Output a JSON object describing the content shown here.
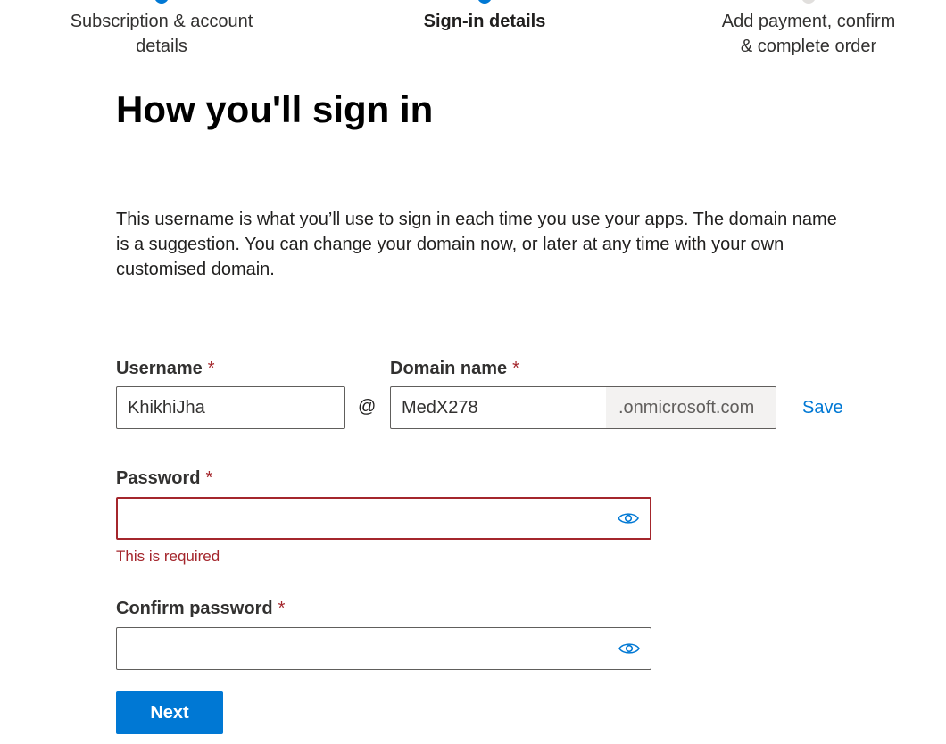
{
  "stepper": {
    "steps": [
      {
        "label_line1": "Subscription & account",
        "label_line2": "details",
        "state": "complete"
      },
      {
        "label_line1": "Sign-in details",
        "label_line2": "",
        "state": "current"
      },
      {
        "label_line1": "Add payment, confirm",
        "label_line2": "& complete order",
        "state": "upcoming"
      }
    ]
  },
  "page": {
    "title": "How you'll sign in",
    "intro": "This username is what you’ll use to sign in each time you use your apps. The domain name is a suggestion. You can change your domain now, or later at any time with your own customised domain."
  },
  "form": {
    "required_marker": "*",
    "username": {
      "label": "Username",
      "value": "KhikhiJha"
    },
    "at_symbol": "@",
    "domain": {
      "label": "Domain name",
      "value": "MedX278",
      "suffix": ".onmicrosoft.com"
    },
    "save_label": "Save",
    "password": {
      "label": "Password",
      "value": "",
      "error": "This is required"
    },
    "confirm_password": {
      "label": "Confirm password",
      "value": ""
    },
    "next_label": "Next",
    "icons": {
      "reveal": "eye-icon"
    }
  },
  "colors": {
    "accent": "#0078d4",
    "error": "#a4262c",
    "suffix_bg": "#f3f2f1"
  }
}
